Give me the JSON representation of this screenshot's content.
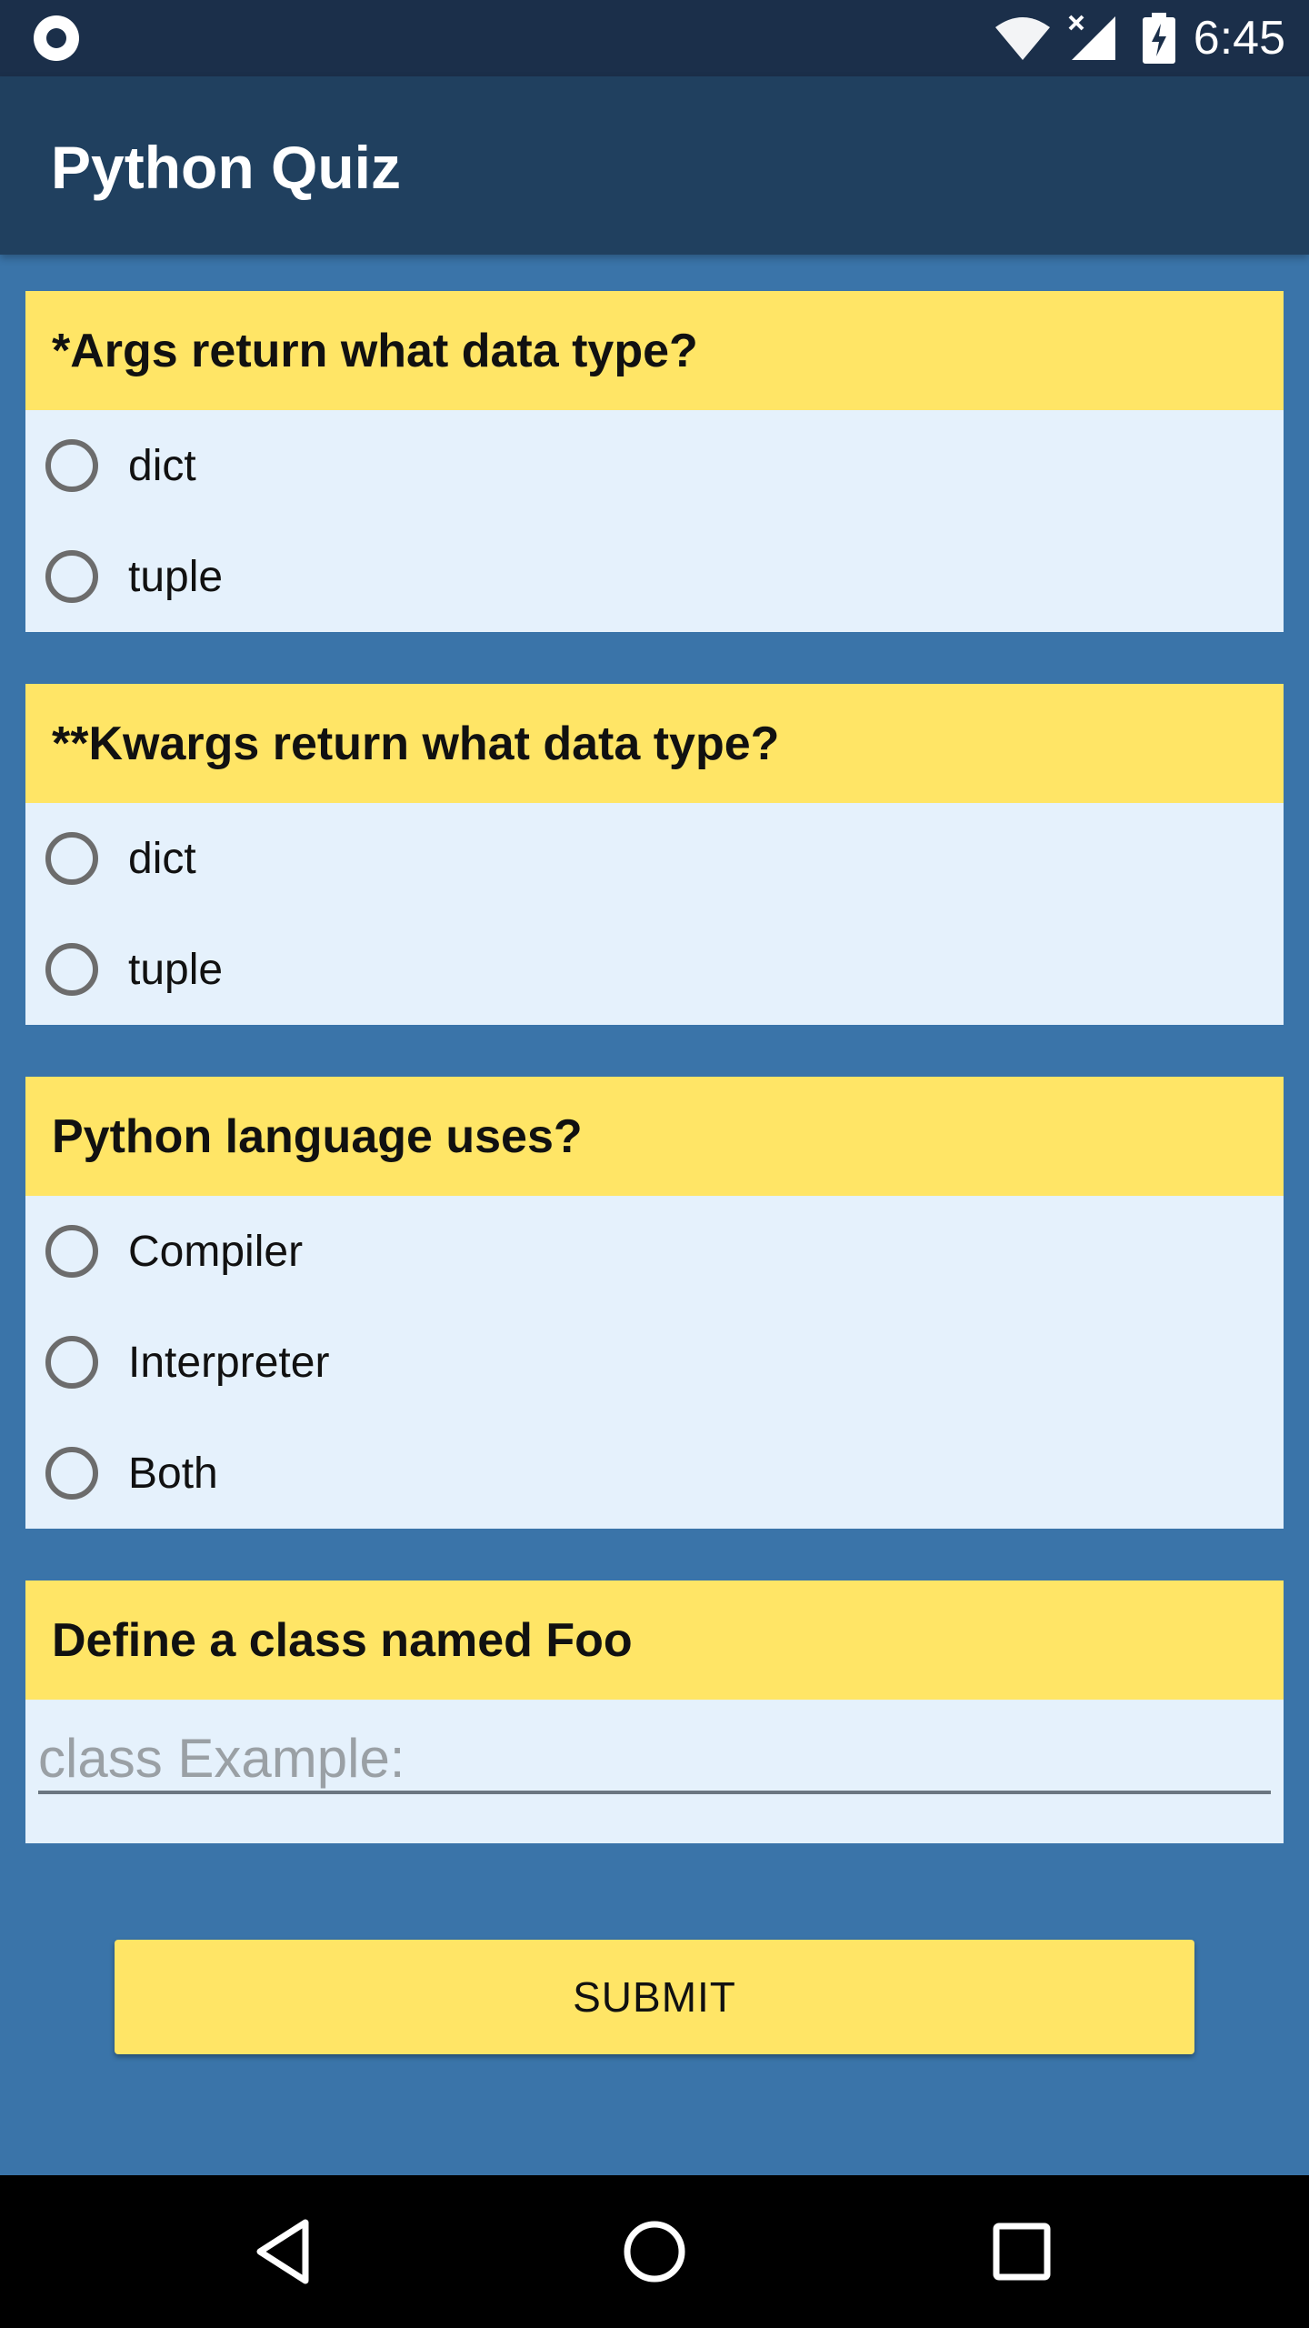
{
  "status_bar": {
    "time": "6:45"
  },
  "app_bar": {
    "title": "Python Quiz"
  },
  "questions": [
    {
      "title": "*Args return what data type?",
      "options": [
        "dict",
        "tuple"
      ]
    },
    {
      "title": "**Kwargs return what data type?",
      "options": [
        "dict",
        "tuple"
      ]
    },
    {
      "title": "Python language uses?",
      "options": [
        "Compiler",
        "Interpreter",
        "Both"
      ]
    },
    {
      "title": "Define a class named Foo",
      "input_placeholder": "class Example:",
      "input_value": ""
    }
  ],
  "submit_label": "SUBMIT",
  "icons": {
    "status": [
      "notification-dot-icon",
      "wifi-icon",
      "signal-icon",
      "battery-charging-icon"
    ],
    "navigation": [
      "back-icon",
      "home-icon",
      "recents-icon"
    ]
  },
  "colors": {
    "background": "#3a74a9",
    "status_bar": "#1b2f4a",
    "app_bar": "#20405f",
    "card_header": "#ffe566",
    "card_body": "#e5f1fc",
    "submit": "#ffe566"
  }
}
